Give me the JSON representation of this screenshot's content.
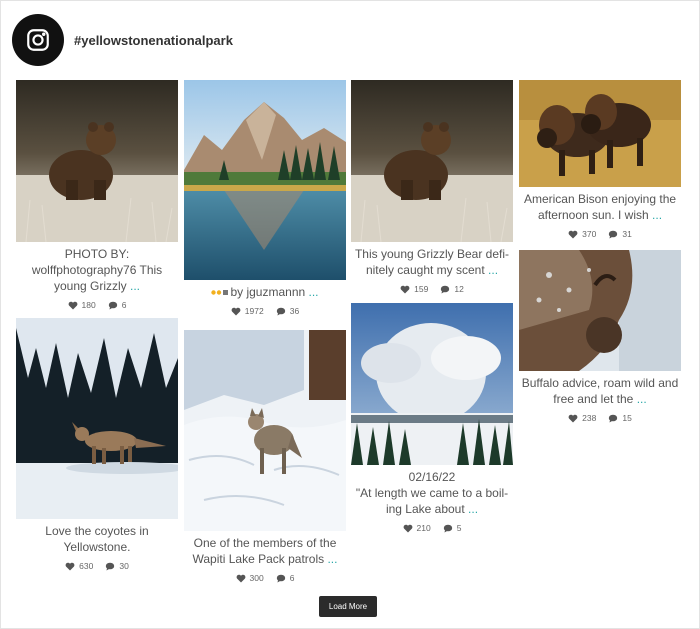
{
  "header": {
    "handle": "#yellowstonenationalpark",
    "icon": "instagram-icon"
  },
  "posts": [
    {
      "image": "grizzly-bear-photo",
      "caption": "PHOTO BY: wolffphotography76 This young Grizzly",
      "more": "...",
      "likes": "180",
      "comments": "6"
    },
    {
      "image": "coyote-photo",
      "caption": "Love the coyotes in Yellowstone.",
      "more": "",
      "likes": "630",
      "comments": "30"
    },
    {
      "image": "mountain-lake-photo",
      "caption": "by jguzmannn",
      "more": "...",
      "likes": "1972",
      "comments": "36"
    },
    {
      "image": "wolf-photo",
      "caption": "One of the members of the Wapiti Lake Pack patrols",
      "more": "...",
      "likes": "300",
      "comments": "6"
    },
    {
      "image": "grizzly-bear-photo",
      "caption": "This young Grizzly Bear defi­nitely caught my scent",
      "more": "...",
      "likes": "159",
      "comments": "12"
    },
    {
      "image": "geyser-steam-photo",
      "caption_line1": "02/16/22",
      "caption": "\"At length we came to a boil­ing Lake about",
      "more": "...",
      "likes": "210",
      "comments": "5"
    },
    {
      "image": "bison-photo",
      "caption": "American Bison enjoying the afternoon sun. I wish",
      "more": "...",
      "likes": "370",
      "comments": "31"
    },
    {
      "image": "frosty-bison-photo",
      "caption": "Buffalo advice, roam wild and free and let the",
      "more": "...",
      "likes": "238",
      "comments": "15"
    }
  ],
  "load_more": "Load More",
  "colors": {
    "link": "#2aa8a8",
    "button": "#2b2b2b"
  }
}
